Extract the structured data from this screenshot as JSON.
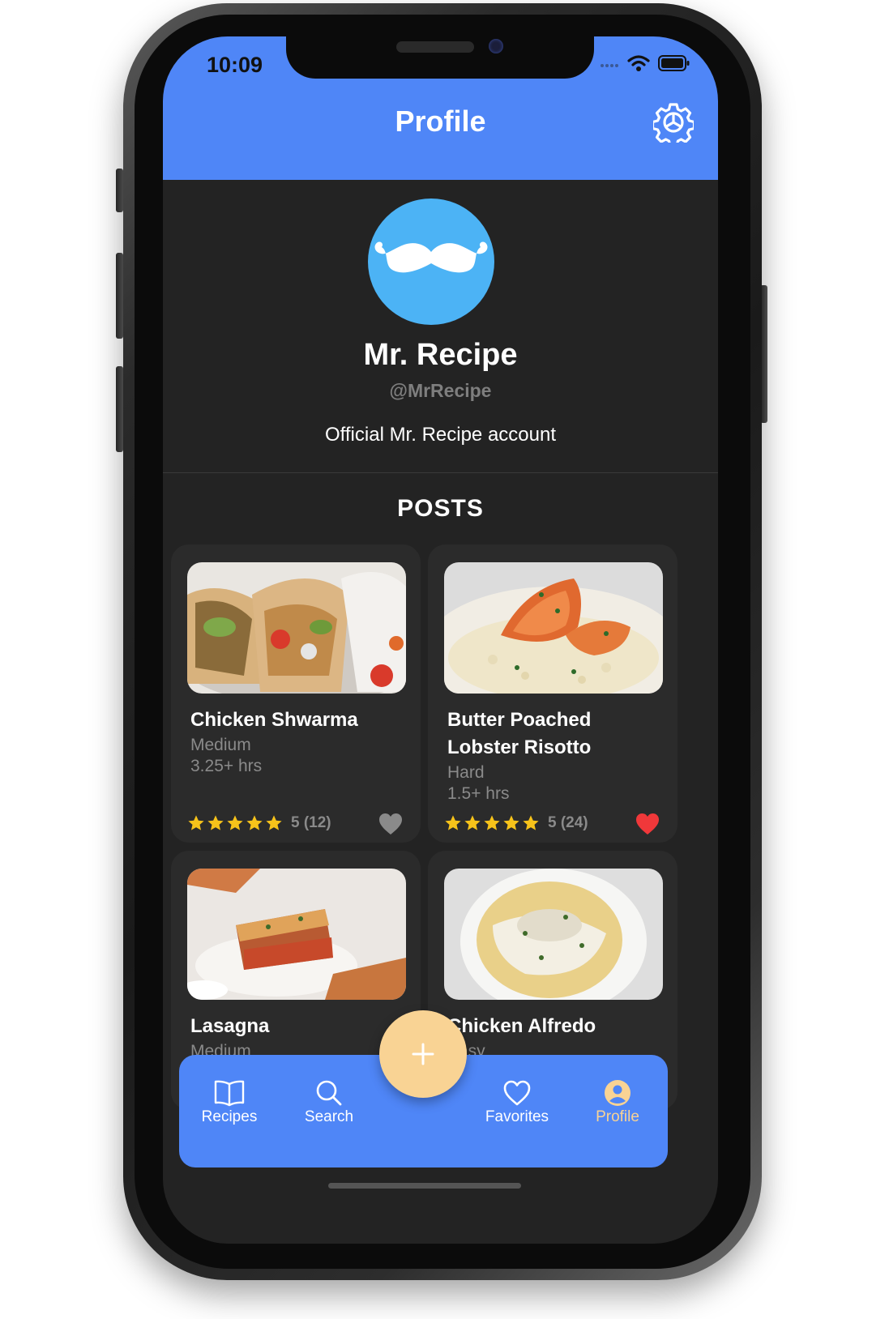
{
  "status_bar": {
    "time": "10:09"
  },
  "header": {
    "title": "Profile",
    "settings_icon": "gear-icon"
  },
  "profile": {
    "avatar_icon": "mustache-icon",
    "name": "Mr. Recipe",
    "handle": "@MrRecipe",
    "bio": "Official Mr. Recipe account"
  },
  "posts": {
    "heading": "POSTS",
    "items": [
      {
        "title": "Chicken Shwarma",
        "difficulty": "Medium",
        "time": "3.25+ hrs",
        "stars": 5,
        "rating": "5 (12)",
        "favorited": false
      },
      {
        "title": "Butter Poached Lobster Risotto",
        "difficulty": "Hard",
        "time": "1.5+ hrs",
        "stars": 5,
        "rating": "5 (24)",
        "favorited": true
      },
      {
        "title": "Lasagna",
        "difficulty": "Medium"
      },
      {
        "title": "Chicken Alfredo",
        "difficulty": "Easy"
      }
    ]
  },
  "tabbar": {
    "tabs": [
      {
        "label": "Recipes",
        "icon": "book-icon"
      },
      {
        "label": "Search",
        "icon": "search-icon"
      },
      {
        "label": "Favorites",
        "icon": "heart-icon"
      },
      {
        "label": "Profile",
        "icon": "user-icon",
        "active": true
      }
    ],
    "fab_icon": "plus-icon"
  },
  "colors": {
    "accent": "#4f86f7",
    "fab": "#f9d394",
    "background": "#232323",
    "card": "#2b2b2b",
    "star": "#f7c31a",
    "heart_active": "#f0383a",
    "heart_inactive": "#8a8a8a"
  }
}
